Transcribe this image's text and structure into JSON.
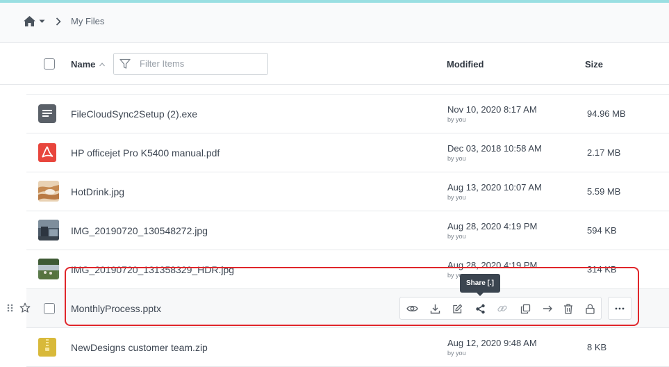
{
  "breadcrumb": {
    "current": "My Files"
  },
  "header": {
    "name_label": "Name",
    "filter_placeholder": "Filter Items",
    "modified_label": "Modified",
    "size_label": "Size"
  },
  "files": [
    {
      "name": "FileCloudSync2Setup (2).exe",
      "modified": "Nov 10, 2020 8:17 AM",
      "by": "by you",
      "size": "94.96 MB",
      "icon": "exe-file-icon"
    },
    {
      "name": "HP officejet Pro K5400 manual.pdf",
      "modified": "Dec 03, 2018 10:58 AM",
      "by": "by you",
      "size": "2.17 MB",
      "icon": "pdf-file-icon"
    },
    {
      "name": "HotDrink.jpg",
      "modified": "Aug 13, 2020 10:07 AM",
      "by": "by you",
      "size": "5.59 MB",
      "icon": "image-thumbnail"
    },
    {
      "name": "IMG_20190720_130548272.jpg",
      "modified": "Aug 28, 2020 4:19 PM",
      "by": "by you",
      "size": "594 KB",
      "icon": "image-thumbnail"
    },
    {
      "name": "IMG_20190720_131358329_HDR.jpg",
      "modified": "Aug 28, 2020 4:19 PM",
      "by": "by you",
      "size": "314 KB",
      "icon": "image-thumbnail"
    },
    {
      "name": "MonthlyProcess.pptx",
      "modified": "",
      "by": "",
      "size": "",
      "icon": "none"
    },
    {
      "name": "NewDesigns customer team.zip",
      "modified": "Aug 12, 2020 9:48 AM",
      "by": "by you",
      "size": "8 KB",
      "icon": "zip-file-icon"
    }
  ],
  "row_actions": [
    "eye-icon",
    "download-icon",
    "edit-icon",
    "share-icon",
    "link-icon",
    "copy-icon",
    "move-icon",
    "trash-icon",
    "lock-icon",
    "more-icon"
  ],
  "tooltip": "Share [.]",
  "colors": {
    "accent_bar": "#9adfe2",
    "highlight_box": "#e0262b",
    "pdf": "#e8453c",
    "zip": "#d8b93a",
    "exe": "#5a6068"
  }
}
